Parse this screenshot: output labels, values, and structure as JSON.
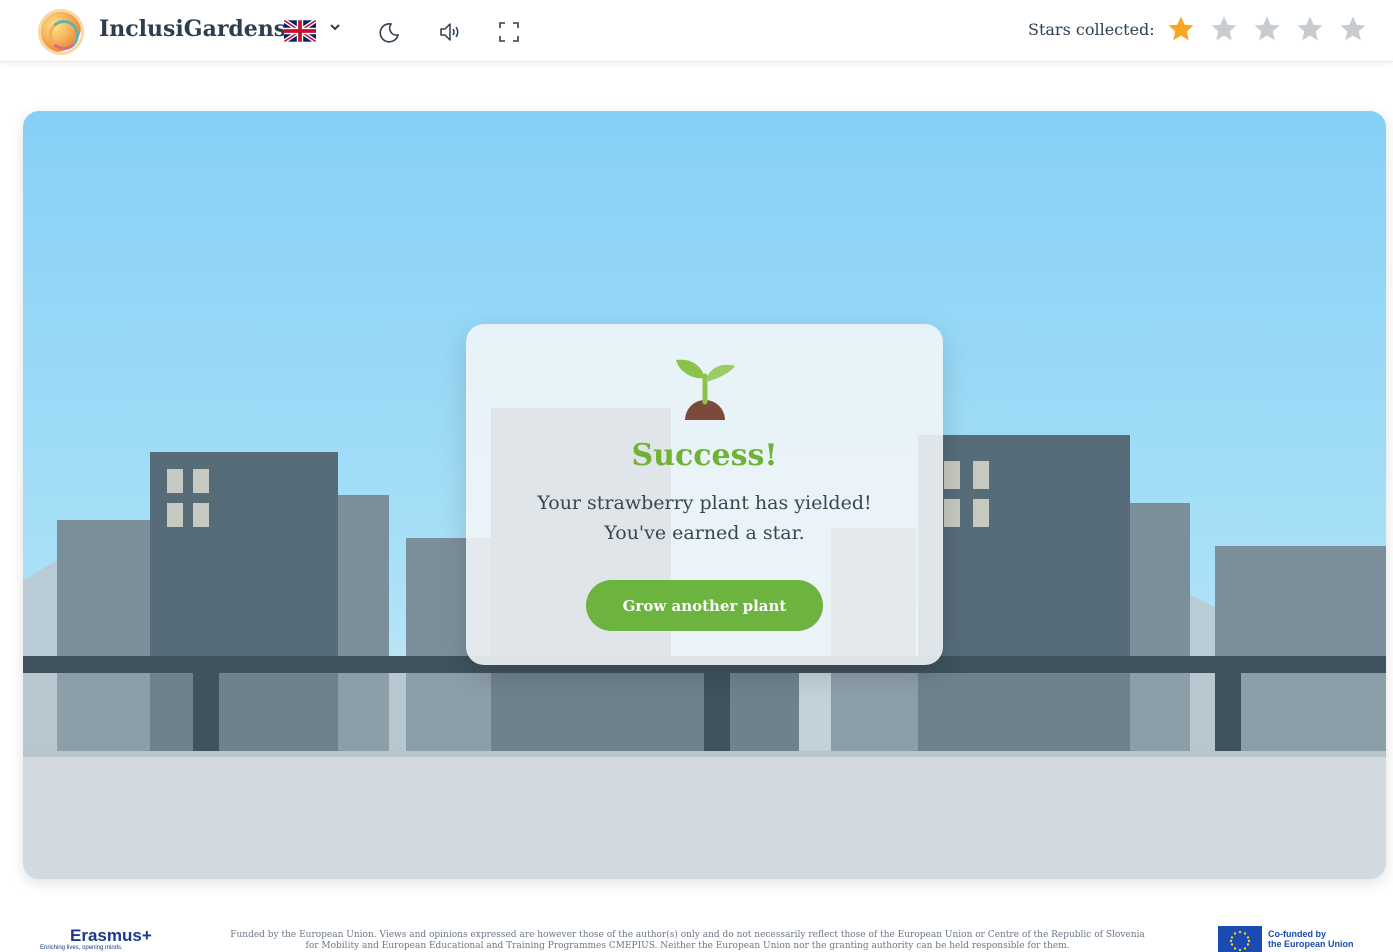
{
  "header": {
    "brand": "InclusiGardens",
    "language_flag": "uk-flag-icon",
    "icons": [
      "chevron-down-icon",
      "moon-icon",
      "speaker-icon",
      "fullscreen-icon"
    ],
    "stars_label": "Stars collected:",
    "stars_collected": 1,
    "stars_total": 5,
    "star_color_on": "#f5a623",
    "star_color_off": "#c7ccd1"
  },
  "modal": {
    "icon": "sprout-icon",
    "title": "Success!",
    "message_line1": "Your strawberry plant has yielded!",
    "message_line2": "You've earned a star.",
    "button_label": "Grow another plant",
    "accent_color": "#6cb43f"
  },
  "footer": {
    "erasmus_logo": "Erasmus+",
    "erasmus_tagline": "Enriching lives, opening minds.",
    "disclaimer_line1": "Funded by the European Union. Views and opinions expressed are however those of the author(s) only and do not necessarily reflect those of the European Union or Centre of the Republic of Slovenia",
    "disclaimer_line2": "for Mobility and European Educational and Training Programmes CMEPIUS. Neither the European Union nor the granting authority can be held responsible for them.",
    "eu_line1": "Co-funded by",
    "eu_line2": "the European Union"
  }
}
